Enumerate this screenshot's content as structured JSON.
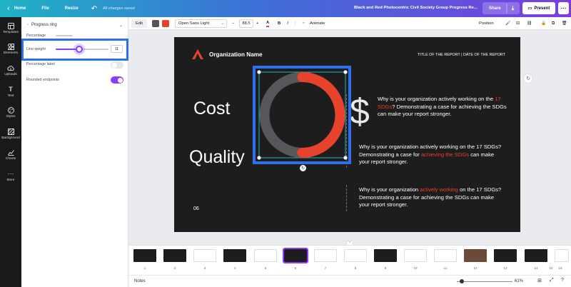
{
  "topbar": {
    "home": "Home",
    "file": "File",
    "resize": "Resize",
    "saved_status": "All changes saved",
    "doc_title": "Black and Red Photocentric Civil Society Group Progress Re...",
    "share": "Share",
    "present": "Present"
  },
  "sidebar": {
    "items": [
      {
        "label": "Templates",
        "icon": "templates-icon"
      },
      {
        "label": "Elements",
        "icon": "elements-icon"
      },
      {
        "label": "Uploads",
        "icon": "uploads-icon"
      },
      {
        "label": "Text",
        "icon": "text-icon"
      },
      {
        "label": "Styles",
        "icon": "styles-icon"
      },
      {
        "label": "Background",
        "icon": "background-icon"
      },
      {
        "label": "Charts",
        "icon": "charts-icon"
      },
      {
        "label": "More",
        "icon": "more-icon"
      }
    ]
  },
  "panel": {
    "title": "Progress ring",
    "percentage_label": "Percentage",
    "line_weight_label": "Line weight",
    "line_weight_value": "11",
    "line_weight_fraction": 0.45,
    "percentage_toggle_label": "Percentage label",
    "percentage_toggle_on": false,
    "rounded_label": "Rounded endpoints",
    "rounded_on": true
  },
  "toolbar": {
    "edit": "Edit",
    "swatch_colors": [
      "#555555",
      "#e8412c"
    ],
    "font": "Open Sans Light",
    "font_size": "88.5",
    "bold": "B",
    "italic": "I",
    "animate": "Animate",
    "position": "Position"
  },
  "slide": {
    "org_name": "Organization Name",
    "report_title": "TITLE OF THE REPORT | DATE OF THE REPORT",
    "cost": "Cost",
    "quality": "Quality",
    "dollar": "$",
    "page_number": "06",
    "ring_progress": 0.5,
    "ring_accent": "#e8412c",
    "ring_track": "#55575b",
    "para1": {
      "a": "Why is your organization actively working on the ",
      "b": "17 SDGs",
      "c": "? Demonstrating a case for achieving the SDGs can make your report stronger."
    },
    "para2": {
      "a": "Why is your organization actively working on the 17 SDGs? Demonstrating a case for ",
      "b": "achieving the SDGs",
      "c": " can make your report stronger."
    },
    "para3": {
      "a": "Why is your organization ",
      "b": "actively working",
      "c": " on the 17 SDGs? Demonstrating a case for achieving the SDGs can make your report stronger."
    }
  },
  "pages": {
    "numbers": [
      "1",
      "2",
      "3",
      "4",
      "5",
      "6",
      "7",
      "8",
      "9",
      "10",
      "11",
      "12",
      "13",
      "14",
      "15",
      "16"
    ],
    "selected": "6"
  },
  "status": {
    "notes": "Notes",
    "zoom": "61%"
  }
}
